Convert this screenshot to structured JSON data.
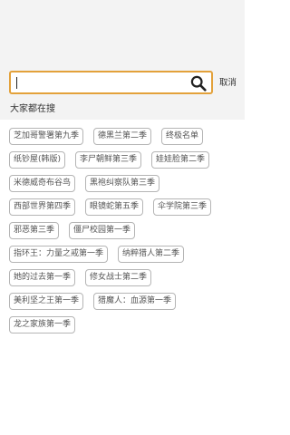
{
  "search": {
    "value": "",
    "placeholder": "",
    "cancel_label": "取消"
  },
  "section_title": "大家都在搜",
  "tag_rows": [
    [
      "芝加哥警署第九季",
      "德黑兰第二季",
      "终极名单"
    ],
    [
      "纸钞屋(韩版)",
      "李尸朝鲜第三季",
      "娃娃脸第二季"
    ],
    [
      "米德威奇布谷鸟",
      "黑袍纠察队第三季"
    ],
    [
      "西部世界第四季",
      "眼镜蛇第五季",
      "伞学院第三季"
    ],
    [
      "邪恶第三季",
      "僵尸校园第一季"
    ],
    [
      "指环王：力量之戒第一季",
      "纳粹猎人第二季"
    ],
    [
      "她的过去第一季",
      "修女战士第二季"
    ],
    [
      "美利坚之王第一季",
      "猎魔人：血源第一季"
    ],
    [
      "龙之家族第一季"
    ]
  ],
  "colors": {
    "accent": "#e3a13a",
    "header_bg": "#f3f3f3",
    "tag_border": "#b5b5b5",
    "tag_text": "#555555"
  },
  "icons": {
    "search": "search-icon"
  }
}
